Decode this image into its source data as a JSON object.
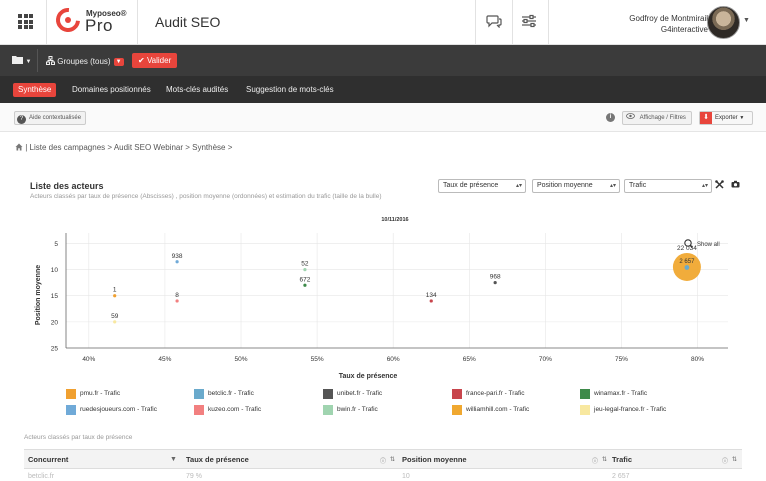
{
  "header": {
    "brand_small": "Myposeo®",
    "brand_big": "Pro",
    "page_title": "Audit SEO",
    "user_name": "Godfroy de Montmirail",
    "user_org": "G4interactive"
  },
  "toolbar": {
    "groups_label": "Groupes (tous)",
    "validate_label": "Valider"
  },
  "nav": {
    "tabs": [
      {
        "label": "Synthèse",
        "active": true
      },
      {
        "label": "Domaines positionnés",
        "active": false
      },
      {
        "label": "Mots-clés audités",
        "active": false
      },
      {
        "label": "Suggestion de mots-clés",
        "active": false
      }
    ]
  },
  "helpbar": {
    "help_label": "Aide contextualisée",
    "display_filters_label": "Affichage / Filtres",
    "export_label": "Exporter"
  },
  "breadcrumb": {
    "text": "| Liste des campagnes > Audit SEO Webinar > Synthèse >"
  },
  "chart_header": {
    "title": "Liste des acteurs",
    "subtitle": "Acteurs classés par taux de présence (Abscisses) , position moyenne (ordonnées) et estimation du trafic (taille de la bulle)",
    "select_x": "Taux de présence",
    "select_y": "Position moyenne",
    "select_size": "Trafic",
    "show_all_label": "Show all"
  },
  "chart_data": {
    "type": "scatter",
    "title": "10/11/2016",
    "xlabel": "Taux de présence",
    "ylabel": "Position moyenne",
    "x_ticks": [
      "40%",
      "45%",
      "50%",
      "55%",
      "60%",
      "65%",
      "70%",
      "75%",
      "80%"
    ],
    "y_ticks": [
      "5",
      "10",
      "15",
      "20",
      "25"
    ],
    "xlim": [
      38.5,
      82
    ],
    "ylim": [
      3,
      25
    ],
    "y_reversed": true,
    "grid": true,
    "series": [
      {
        "name": "pmu.fr - Trafic",
        "color": "#f0a030",
        "points": [
          {
            "x": 41.7,
            "y": 15,
            "label": "1"
          }
        ]
      },
      {
        "name": "betclic.fr - Trafic",
        "color": "#6aaacc",
        "points": [
          {
            "x": 79.3,
            "y": 9.6,
            "label": ""
          }
        ]
      },
      {
        "name": "unibet.fr - Trafic",
        "color": "#555555",
        "points": [
          {
            "x": 66.7,
            "y": 12.5,
            "label": "968"
          }
        ]
      },
      {
        "name": "france-pari.fr - Trafic",
        "color": "#c8454c",
        "points": [
          {
            "x": 62.5,
            "y": 16,
            "label": "134"
          }
        ]
      },
      {
        "name": "winamax.fr - Trafic",
        "color": "#3e8a4a",
        "points": [
          {
            "x": 54.2,
            "y": 13,
            "label": "672"
          }
        ]
      },
      {
        "name": "ruedesjoueurs.com - Trafic",
        "color": "#70aad8",
        "points": [
          {
            "x": 45.8,
            "y": 8.5,
            "label": "938"
          }
        ]
      },
      {
        "name": "kuzeo.com - Trafic",
        "color": "#f28080",
        "points": [
          {
            "x": 45.8,
            "y": 16,
            "label": "8"
          }
        ]
      },
      {
        "name": "bwin.fr - Trafic",
        "color": "#a0d4b0",
        "points": [
          {
            "x": 54.2,
            "y": 10,
            "label": "52"
          }
        ]
      },
      {
        "name": "williamhill.com - Trafic",
        "color": "#f0a830",
        "points": [
          {
            "x": 79.3,
            "y": 9.5,
            "label": "22 034",
            "big": true
          }
        ]
      },
      {
        "name": "jeu-legal-france.fr - Trafic",
        "color": "#f8e8a0",
        "points": [
          {
            "x": 41.7,
            "y": 20,
            "label": "59"
          }
        ]
      }
    ],
    "bubble_inner_label": "2 657"
  },
  "table": {
    "caption": "Acteurs classés par taux de présence",
    "columns": [
      "Concurrent",
      "Taux de présence",
      "Position moyenne",
      "Trafic"
    ],
    "rows": [
      [
        "betclic.fr",
        "79 %",
        "10",
        "2 657"
      ]
    ]
  }
}
